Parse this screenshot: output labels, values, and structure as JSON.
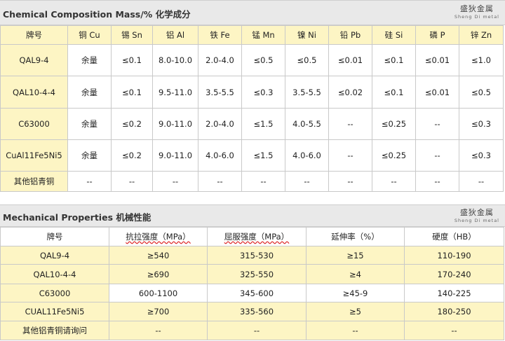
{
  "composition": {
    "title": "Chemical Composition    Mass/%  化学成分",
    "brand_cn": "盛狄金属",
    "brand_en": "Sheng Di metal",
    "headers": [
      "牌号",
      "铜 Cu",
      "锡 Sn",
      "铝 Al",
      "铁 Fe",
      "锰 Mn",
      "镍 Ni",
      "铅 Pb",
      "硅 Si",
      "磷 P",
      "锌 Zn"
    ],
    "rows": [
      [
        "QAL9-4",
        "余量",
        "≤0.1",
        "8.0-10.0",
        "2.0-4.0",
        "≤0.5",
        "≤0.5",
        "≤0.01",
        "≤0.1",
        "≤0.01",
        "≤1.0"
      ],
      [
        "QAL10-4-4",
        "余量",
        "≤0.1",
        "9.5-11.0",
        "3.5-5.5",
        "≤0.3",
        "3.5-5.5",
        "≤0.02",
        "≤0.1",
        "≤0.01",
        "≤0.5"
      ],
      [
        "C63000",
        "余量",
        "≤0.2",
        "9.0-11.0",
        "2.0-4.0",
        "≤1.5",
        "4.0-5.5",
        "--",
        "≤0.25",
        "--",
        "≤0.3"
      ],
      [
        "CuAl11Fe5Ni5",
        "余量",
        "≤0.2",
        "9.0-11.0",
        "4.0-6.0",
        "≤1.5",
        "4.0-6.0",
        "--",
        "≤0.25",
        "--",
        "≤0.3"
      ],
      [
        "其他铝青铜",
        "--",
        "--",
        "--",
        "--",
        "--",
        "--",
        "--",
        "--",
        "--",
        "--"
      ]
    ]
  },
  "mechanical": {
    "title": "Mechanical Properties 机械性能",
    "brand_cn": "盛狄金属",
    "brand_en": "Sheng Di metal",
    "headers": [
      "牌号",
      "抗拉强度（MPa）",
      "屈服强度（MPa）",
      "延伸率（%）",
      "硬度（HB）"
    ],
    "rows": [
      [
        "QAL9-4",
        "≥540",
        "315-530",
        "≥15",
        "110-190"
      ],
      [
        "QAL10-4-4",
        "≥690",
        "325-550",
        "≥4",
        "170-240"
      ],
      [
        "C63000",
        "600-1100",
        "345-600",
        "≥45-9",
        "140-225"
      ],
      [
        "CUAL11Fe5Ni5",
        "≥700",
        "335-560",
        "≥5",
        "180-250"
      ],
      [
        "其他铝青铜请询问",
        "--",
        "--",
        "--",
        "--"
      ]
    ]
  }
}
